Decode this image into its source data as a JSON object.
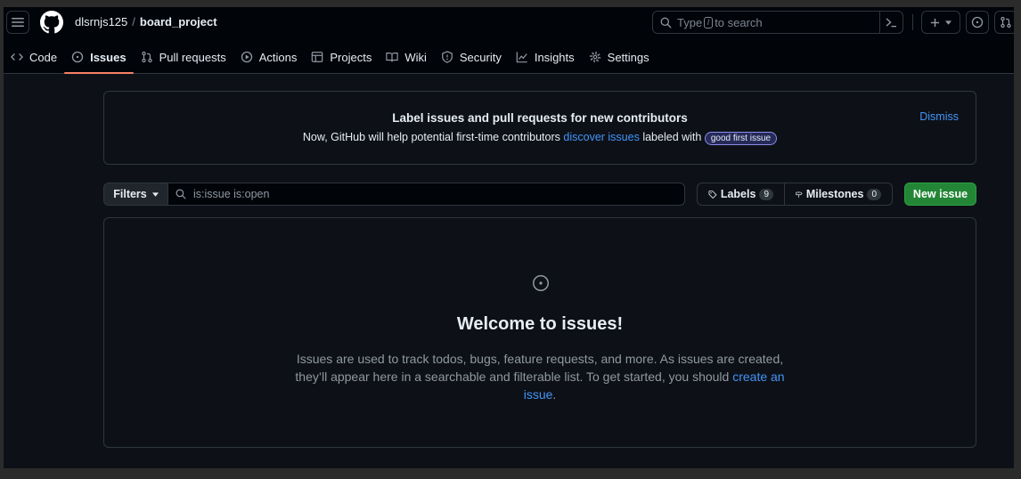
{
  "header": {
    "owner": "dlsrnjs125",
    "separator": "/",
    "repo": "board_project",
    "search_prefix": "Type",
    "search_key": "/",
    "search_suffix": "to search"
  },
  "nav": {
    "items": [
      {
        "label": "Code",
        "icon": "code-icon"
      },
      {
        "label": "Issues",
        "icon": "issue-opened-icon",
        "active": true
      },
      {
        "label": "Pull requests",
        "icon": "git-pull-request-icon"
      },
      {
        "label": "Actions",
        "icon": "play-icon"
      },
      {
        "label": "Projects",
        "icon": "table-icon"
      },
      {
        "label": "Wiki",
        "icon": "book-icon"
      },
      {
        "label": "Security",
        "icon": "shield-icon"
      },
      {
        "label": "Insights",
        "icon": "graph-icon"
      },
      {
        "label": "Settings",
        "icon": "gear-icon"
      }
    ]
  },
  "banner": {
    "title": "Label issues and pull requests for new contributors",
    "text_before": "Now, GitHub will help potential first-time contributors",
    "link": "discover issues",
    "text_after": "labeled with",
    "label": "good first issue",
    "dismiss": "Dismiss"
  },
  "toolbar": {
    "filters": "Filters",
    "query": "is:issue is:open",
    "labels": "Labels",
    "labels_count": "9",
    "milestones": "Milestones",
    "milestones_count": "0",
    "new_issue": "New issue"
  },
  "blankslate": {
    "title": "Welcome to issues!",
    "text": "Issues are used to track todos, bugs, feature requests, and more. As issues are created, they’ll appear here in a searchable and filterable list. To get started, you should",
    "link": "create an issue",
    "end": "."
  },
  "colors": {
    "accent_underline": "#f78166",
    "link": "#4493f8",
    "primary_button": "#238636"
  }
}
